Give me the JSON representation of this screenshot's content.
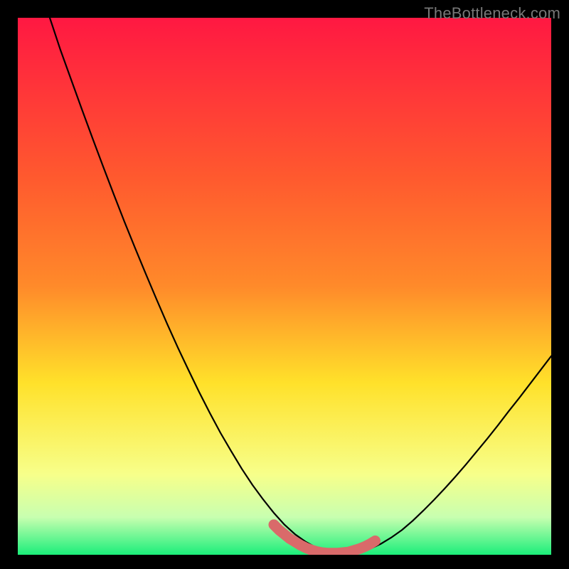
{
  "watermark": "TheBottleneck.com",
  "colors": {
    "gradient_top": "#ff1842",
    "gradient_mid1": "#ff8a2a",
    "gradient_mid2": "#ffe12a",
    "gradient_mid3": "#f7ff8a",
    "gradient_bottom": "#1bee7a",
    "curve": "#000000",
    "marker": "#d96a6a",
    "frame": "#000000"
  },
  "chart_data": {
    "type": "line",
    "title": "",
    "xlabel": "",
    "ylabel": "",
    "xlim": [
      0,
      100
    ],
    "ylim": [
      0,
      100
    ],
    "series": [
      {
        "name": "bottleneck-curve",
        "x": [
          6,
          8,
          10,
          12,
          14,
          16,
          18,
          20,
          22,
          24,
          26,
          28,
          30,
          32,
          34,
          36,
          38,
          40,
          42,
          44,
          46,
          48,
          50,
          52,
          54,
          56,
          58,
          60,
          62,
          64,
          66,
          68,
          70,
          72,
          74,
          76,
          78,
          80,
          82,
          84,
          86,
          88,
          90,
          92,
          94,
          96,
          98,
          100
        ],
        "y": [
          100,
          94,
          88.5,
          83,
          77.6,
          72.3,
          67.1,
          62,
          57.1,
          52.3,
          47.6,
          43,
          38.6,
          34.4,
          30.3,
          26.4,
          22.7,
          19.3,
          16,
          13,
          10.3,
          7.8,
          5.6,
          3.8,
          2.4,
          1.3,
          0.6,
          0.3,
          0.3,
          0.5,
          1.1,
          2,
          3.2,
          4.6,
          6.3,
          8.2,
          10.2,
          12.3,
          14.5,
          16.8,
          19.2,
          21.6,
          24.1,
          26.7,
          29.2,
          31.8,
          34.4,
          37
        ]
      },
      {
        "name": "near-zero-marker",
        "x": [
          48,
          49,
          50,
          51,
          52,
          53,
          54,
          55,
          56,
          57,
          58,
          59,
          60,
          61,
          62,
          63,
          64,
          65,
          66,
          67
        ],
        "y": [
          5.6,
          4.6,
          3.8,
          3.0,
          2.4,
          1.8,
          1.3,
          0.9,
          0.6,
          0.4,
          0.3,
          0.3,
          0.3,
          0.4,
          0.5,
          0.8,
          1.1,
          1.5,
          2.0,
          2.6
        ]
      }
    ]
  }
}
